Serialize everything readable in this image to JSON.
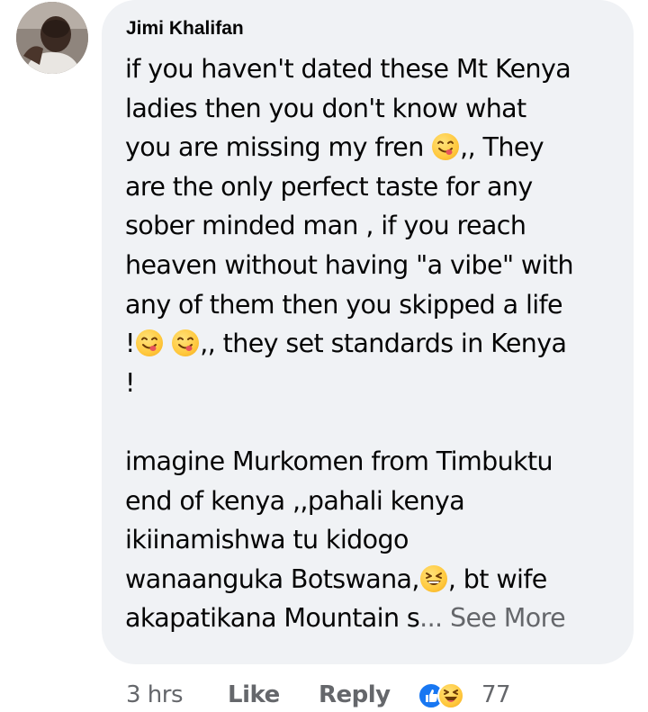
{
  "comment": {
    "author": "Jimi Khalifan",
    "lines": [
      "if you haven't dated these Mt Kenya",
      "ladies then you don't know what",
      "you are missing my fren",
      ",, They",
      "are the only perfect taste for any",
      "sober minded man , if you reach",
      "heaven without having \"a vibe\" with",
      "any of them then you skipped a life",
      "!",
      ",, they set standards in Kenya",
      "!",
      "imagine Murkomen from Timbuktu",
      "end of kenya ,,pahali kenya",
      "ikiinamishwa tu kidogo",
      "wanaanguka Botswana,",
      ", bt wife",
      "akapatikana Mountain s",
      "..."
    ],
    "see_more": "See More",
    "emojis": [
      "face-savoring-food-icon",
      "grinning-squinting-face-icon"
    ]
  },
  "meta": {
    "time": "3 hrs",
    "like_label": "Like",
    "reply_label": "Reply",
    "reaction_count": "77",
    "reactions": [
      "like-reaction-icon",
      "haha-reaction-icon"
    ]
  },
  "colors": {
    "bubble": "#f0f2f5",
    "text": "#050505",
    "secondary": "#65676b",
    "like_blue": "#1877f2"
  }
}
